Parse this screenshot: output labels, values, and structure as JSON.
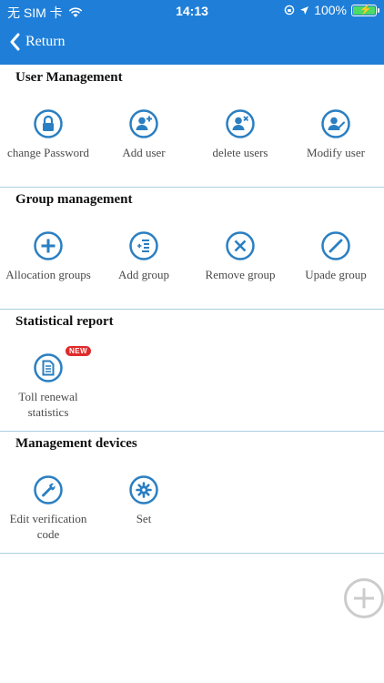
{
  "status_bar": {
    "carrier": "无 SIM 卡",
    "time": "14:13",
    "battery": "100%"
  },
  "nav": {
    "back_label": "Return"
  },
  "sections": [
    {
      "title": "User Management",
      "items": [
        {
          "label": "change Password",
          "icon": "lock-icon"
        },
        {
          "label": "Add user",
          "icon": "user-add-icon"
        },
        {
          "label": "delete users",
          "icon": "user-delete-icon"
        },
        {
          "label": "Modify user",
          "icon": "user-edit-icon"
        }
      ]
    },
    {
      "title": "Group management",
      "items": [
        {
          "label": "Allocation groups",
          "icon": "plus-circle-icon"
        },
        {
          "label": "Add group",
          "icon": "list-add-icon"
        },
        {
          "label": "Remove group",
          "icon": "close-circle-icon"
        },
        {
          "label": "Upade group",
          "icon": "pencil-icon"
        }
      ]
    },
    {
      "title": "Statistical report",
      "items": [
        {
          "label_line1": "Toll renewal",
          "label_line2": "statistics",
          "icon": "document-icon",
          "badge": "NEW"
        }
      ]
    },
    {
      "title": "Management devices",
      "items": [
        {
          "label_line1": "Edit verification",
          "label_line2": "code",
          "icon": "wrench-icon"
        },
        {
          "label": "Set",
          "icon": "gear-icon"
        }
      ]
    }
  ],
  "colors": {
    "header": "#1f7fd8",
    "icon": "#2a7fc2",
    "divider": "#a9cfe3",
    "fab": "#cccccc"
  }
}
